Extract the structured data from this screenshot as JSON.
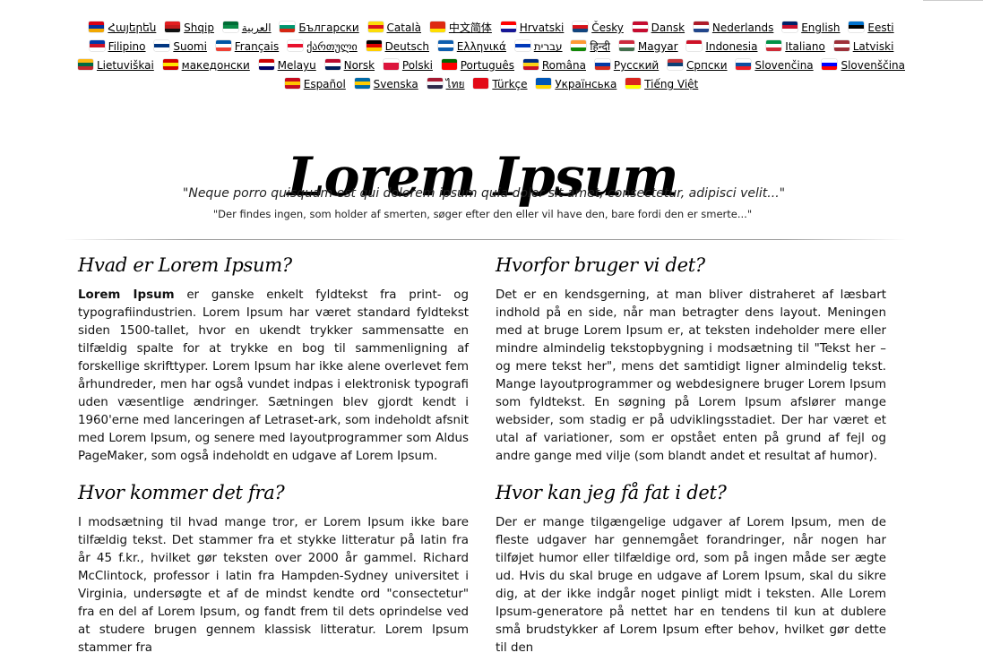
{
  "languages": [
    {
      "label": "Հայերեն",
      "flag": [
        "#d90012",
        "#0033a0",
        "#f2a800"
      ]
    },
    {
      "label": "Shqip",
      "flag": [
        "#e41e20",
        "#c21b1b",
        "#111111"
      ]
    },
    {
      "label": "العربية",
      "flag": [
        "#006c35",
        "#0a8a47",
        "#ffffff"
      ]
    },
    {
      "label": "Български",
      "flag": [
        "#ffffff",
        "#00966e",
        "#d62612"
      ]
    },
    {
      "label": "Català",
      "flag": [
        "#fcdd09",
        "#da121a",
        "#fcdd09"
      ]
    },
    {
      "label": "中文简体",
      "flag": [
        "#de2910",
        "#de2910",
        "#ffde00"
      ]
    },
    {
      "label": "Hrvatski",
      "flag": [
        "#ff0000",
        "#ffffff",
        "#171796"
      ]
    },
    {
      "label": "Česky",
      "flag": [
        "#ffffff",
        "#d7141a",
        "#11457e"
      ]
    },
    {
      "label": "Dansk",
      "flag": [
        "#c60c30",
        "#ffffff",
        "#c60c30"
      ]
    },
    {
      "label": "Nederlands",
      "flag": [
        "#ae1c28",
        "#ffffff",
        "#21468b"
      ]
    },
    {
      "label": "English",
      "flag": [
        "#012169",
        "#c8102e",
        "#ffffff"
      ]
    },
    {
      "label": "Eesti",
      "flag": [
        "#0072ce",
        "#000000",
        "#ffffff"
      ]
    },
    {
      "label": "Filipino",
      "flag": [
        "#0038a8",
        "#ce1126",
        "#ffffff"
      ]
    },
    {
      "label": "Suomi",
      "flag": [
        "#ffffff",
        "#003580",
        "#ffffff"
      ]
    },
    {
      "label": "Français",
      "flag": [
        "#0055a4",
        "#ffffff",
        "#ef4135"
      ]
    },
    {
      "label": "ქართული",
      "flag": [
        "#ffffff",
        "#e8112d",
        "#ffffff"
      ]
    },
    {
      "label": "Deutsch",
      "flag": [
        "#000000",
        "#dd0000",
        "#ffce00"
      ]
    },
    {
      "label": "Ελληνικά",
      "flag": [
        "#0d5eaf",
        "#ffffff",
        "#0d5eaf"
      ]
    },
    {
      "label": "עברית",
      "flag": [
        "#ffffff",
        "#0038b8",
        "#ffffff"
      ]
    },
    {
      "label": "हिन्दी",
      "flag": [
        "#ff9933",
        "#ffffff",
        "#138808"
      ]
    },
    {
      "label": "Magyar",
      "flag": [
        "#cd2a3e",
        "#ffffff",
        "#436f4d"
      ]
    },
    {
      "label": "Indonesia",
      "flag": [
        "#ce1126",
        "#ffffff",
        "#ffffff"
      ]
    },
    {
      "label": "Italiano",
      "flag": [
        "#009246",
        "#ffffff",
        "#ce2b37"
      ]
    },
    {
      "label": "Latviski",
      "flag": [
        "#9e3039",
        "#ffffff",
        "#9e3039"
      ]
    },
    {
      "label": "Lietuviškai",
      "flag": [
        "#fdb913",
        "#006a44",
        "#c1272d"
      ]
    },
    {
      "label": "македонски",
      "flag": [
        "#d20000",
        "#ffe600",
        "#d20000"
      ]
    },
    {
      "label": "Melayu",
      "flag": [
        "#cc0001",
        "#ffffff",
        "#010066"
      ]
    },
    {
      "label": "Norsk",
      "flag": [
        "#ba0c2f",
        "#ffffff",
        "#00205b"
      ]
    },
    {
      "label": "Polski",
      "flag": [
        "#ffffff",
        "#dc143c",
        "#dc143c"
      ]
    },
    {
      "label": "Português",
      "flag": [
        "#006600",
        "#ff0000",
        "#ff0000"
      ]
    },
    {
      "label": "Româna",
      "flag": [
        "#002b7f",
        "#fcd116",
        "#ce1126"
      ]
    },
    {
      "label": "Русский",
      "flag": [
        "#ffffff",
        "#0039a6",
        "#d52b1e"
      ]
    },
    {
      "label": "Српски",
      "flag": [
        "#c6363c",
        "#0c4076",
        "#ffffff"
      ]
    },
    {
      "label": "Slovenčina",
      "flag": [
        "#ffffff",
        "#0b4ea2",
        "#ee1c25"
      ]
    },
    {
      "label": "Slovenščina",
      "flag": [
        "#ffffff",
        "#0000ff",
        "#ff0000"
      ]
    },
    {
      "label": "Español",
      "flag": [
        "#c60b1e",
        "#ffc400",
        "#c60b1e"
      ]
    },
    {
      "label": "Svenska",
      "flag": [
        "#006aa7",
        "#fecc00",
        "#006aa7"
      ]
    },
    {
      "label": "ไทย",
      "flag": [
        "#a51931",
        "#f4f5f8",
        "#2d2a4a"
      ]
    },
    {
      "label": "Türkçe",
      "flag": [
        "#e30a17",
        "#e30a17",
        "#e30a17"
      ]
    },
    {
      "label": "Українська",
      "flag": [
        "#0057b7",
        "#0057b7",
        "#ffd700"
      ]
    },
    {
      "label": "Tiếng Việt",
      "flag": [
        "#da251d",
        "#da251d",
        "#ffff00"
      ]
    }
  ],
  "title": "Lorem Ipsum",
  "quote_latin": "\"Neque porro quisquam est qui dolorem ipsum quia dolor sit amet, consectetur, adipisci velit...\"",
  "quote_danish": "\"Der findes ingen, som holder af smerten, søger efter den eller vil have den, bare fordi den er smerte...\"",
  "sections": {
    "what": {
      "heading": "Hvad er Lorem Ipsum?",
      "lead": "Lorem Ipsum",
      "body": " er ganske enkelt fyldtekst fra print- og typografiindustrien. Lorem Ipsum har været standard fyldtekst siden 1500-tallet, hvor en ukendt trykker sammensatte en tilfældig spalte for at trykke en bog til sammenligning af forskellige skrifttyper. Lorem Ipsum har ikke alene overlevet fem århundreder, men har også vundet indpas i elektronisk typografi uden væsentlige ændringer. Sætningen blev gjordt kendt i 1960'erne med lanceringen af Letraset-ark, som indeholdt afsnit med Lorem Ipsum, og senere med layoutprogrammer som Aldus PageMaker, som også indeholdt en udgave af Lorem Ipsum."
    },
    "why": {
      "heading": "Hvorfor bruger vi det?",
      "body": "Det er en kendsgerning, at man bliver distraheret af læsbart indhold på en side, når man betragter dens layout. Meningen med at bruge Lorem Ipsum er, at teksten indeholder mere eller mindre almindelig tekstopbygning i modsætning til \"Tekst her – og mere tekst her\", mens det samtidigt ligner almindelig tekst. Mange layoutprogrammer og webdesignere bruger Lorem Ipsum som fyldtekst. En søgning på Lorem Ipsum afslører mange websider, som stadig er på udviklingsstadiet. Der har været et utal af variationer, som er opstået enten på grund af fejl og andre gange med vilje (som blandt andet et resultat af humor)."
    },
    "where_from": {
      "heading": "Hvor kommer det fra?",
      "body": "I modsætning til hvad mange tror, er Lorem Ipsum ikke bare tilfældig tekst. Det stammer fra et stykke litteratur på latin fra år 45 f.kr., hvilket gør teksten over 2000 år gammel. Richard McClintock, professor i latin fra Hampden-Sydney universitet i Virginia, undersøgte et af de mindst kendte ord \"consectetur\" fra en del af Lorem Ipsum, og fandt frem til dets oprindelse ved at studere brugen gennem klassisk litteratur. Lorem Ipsum stammer fra"
    },
    "where_get": {
      "heading": "Hvor kan jeg få fat i det?",
      "body": "Der er mange tilgængelige udgaver af Lorem Ipsum, men de fleste udgaver har gennemgået forandringer, når nogen har tilføjet humor eller tilfældige ord, som på ingen måde ser ægte ud. Hvis du skal bruge en udgave af Lorem Ipsum, skal du sikre dig, at der ikke indgår noget pinligt midt i teksten. Alle Lorem Ipsum-generatore på nettet har en tendens til kun at dublere små brudstykker af Lorem Ipsum efter behov, hvilket gør dette til den"
    }
  }
}
